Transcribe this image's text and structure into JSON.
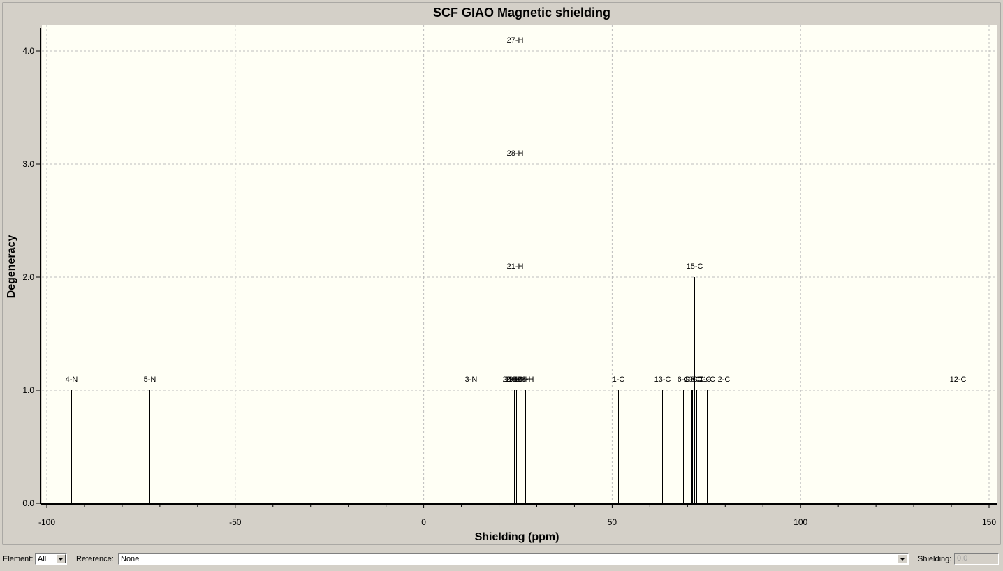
{
  "chart_data": {
    "type": "bar",
    "title": "SCF GIAO Magnetic shielding",
    "xlabel": "Shielding (ppm)",
    "ylabel": "Degeneracy",
    "xlim": [
      -100,
      150
    ],
    "ylim": [
      0,
      4.2
    ],
    "xticks": [
      {
        "value": -100,
        "label": "-100"
      },
      {
        "value": -50,
        "label": "-50"
      },
      {
        "value": 0,
        "label": "0"
      },
      {
        "value": 50,
        "label": "50"
      },
      {
        "value": 100,
        "label": "100"
      },
      {
        "value": 150,
        "label": "150"
      }
    ],
    "yticks": [
      {
        "value": 0,
        "label": "0.0"
      },
      {
        "value": 1,
        "label": "1.0"
      },
      {
        "value": 2,
        "label": "2.0"
      },
      {
        "value": 3,
        "label": "3.0"
      },
      {
        "value": 4,
        "label": "4.0"
      }
    ],
    "grid": true,
    "peaks": [
      {
        "x": -93.6,
        "y": 1,
        "label": "4-N"
      },
      {
        "x": -72.8,
        "y": 1,
        "label": "5-N"
      },
      {
        "x": 12.4,
        "y": 1,
        "label": "3-N"
      },
      {
        "x": 23.1,
        "y": 1,
        "label": "20-H"
      },
      {
        "x": 23.6,
        "y": 1,
        "label": "19-H"
      },
      {
        "x": 23.9,
        "y": 1,
        "label": "24-H"
      },
      {
        "x": 24.1,
        "y": 4,
        "label": "27-H"
      },
      {
        "x": 24.1,
        "y": 3,
        "label": "28-H"
      },
      {
        "x": 24.1,
        "y": 2,
        "label": "21-H"
      },
      {
        "x": 24.6,
        "y": 1,
        "label": "18-H"
      },
      {
        "x": 26.0,
        "y": 1,
        "label": "16-H"
      },
      {
        "x": 26.9,
        "y": 1,
        "label": "26-H"
      },
      {
        "x": 51.6,
        "y": 1,
        "label": "1-C"
      },
      {
        "x": 63.3,
        "y": 1,
        "label": "13-C"
      },
      {
        "x": 68.9,
        "y": 1,
        "label": "6-C"
      },
      {
        "x": 71.0,
        "y": 1,
        "label": "9-C"
      },
      {
        "x": 71.3,
        "y": 1,
        "label": "10-C"
      },
      {
        "x": 71.8,
        "y": 2,
        "label": "15-C"
      },
      {
        "x": 72.3,
        "y": 1,
        "label": "8-C"
      },
      {
        "x": 74.6,
        "y": 1,
        "label": "7-C"
      },
      {
        "x": 75.2,
        "y": 1,
        "label": "11-C"
      },
      {
        "x": 79.5,
        "y": 1,
        "label": "2-C"
      },
      {
        "x": 141.7,
        "y": 1,
        "label": "12-C"
      }
    ],
    "colors": {
      "plot_bg": "#fffff5",
      "grid": "#bdbdbd",
      "line": "#000000"
    }
  },
  "bottom_bar": {
    "element_label": "Element:",
    "element_value": "All",
    "reference_label": "Reference:",
    "reference_value": "None",
    "shielding_label": "Shielding:",
    "shielding_value": "0.0"
  }
}
